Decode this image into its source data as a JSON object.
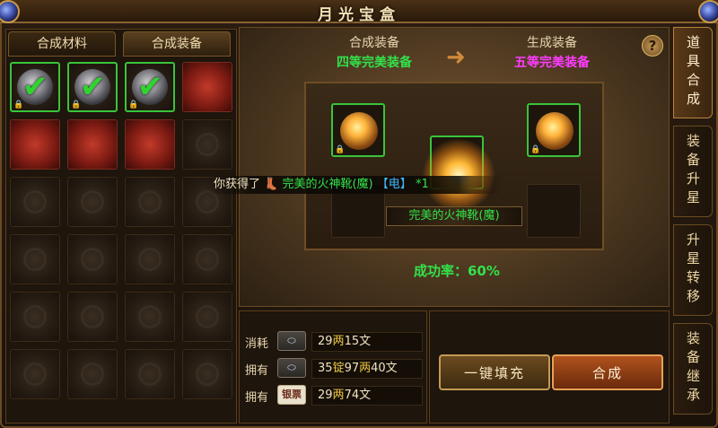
{
  "window": {
    "title": "月光宝盒"
  },
  "left_tabs": [
    {
      "label": "合成材料"
    },
    {
      "label": "合成装备"
    }
  ],
  "header": {
    "input_label": "合成装备",
    "input_tier": "四等完美装备",
    "output_label": "生成装备",
    "output_tier": "五等完美装备",
    "help": "?"
  },
  "toast": {
    "prefix": "你获得了",
    "item": "完美的火神靴(魔)",
    "tag": "【电】",
    "count": "*1"
  },
  "result_name": "完美的火神靴(魔)",
  "success_rate": "成功率：60%",
  "costs": [
    {
      "label": "消耗",
      "icon": "silver-icon",
      "icon_text": "",
      "parts": [
        "29",
        "两",
        "15文"
      ]
    },
    {
      "label": "拥有",
      "icon": "silver-icon",
      "icon_text": "",
      "parts": [
        "35",
        "锭",
        "97",
        "两",
        "40文"
      ]
    },
    {
      "label": "拥有",
      "icon": "banknote-icon",
      "icon_text": "银票",
      "parts": [
        "29",
        "两",
        "74文"
      ]
    }
  ],
  "buttons": {
    "auto_fill": "一键填充",
    "craft": "合成"
  },
  "side_tabs": [
    {
      "label": "道具合成"
    },
    {
      "label": "装备升星"
    },
    {
      "label": "升星转移"
    },
    {
      "label": "装备继承"
    }
  ],
  "colors": {
    "green": "#33e04a",
    "magenta": "#ff3cff",
    "gold": "#f0c840",
    "blue": "#42b6ff"
  }
}
